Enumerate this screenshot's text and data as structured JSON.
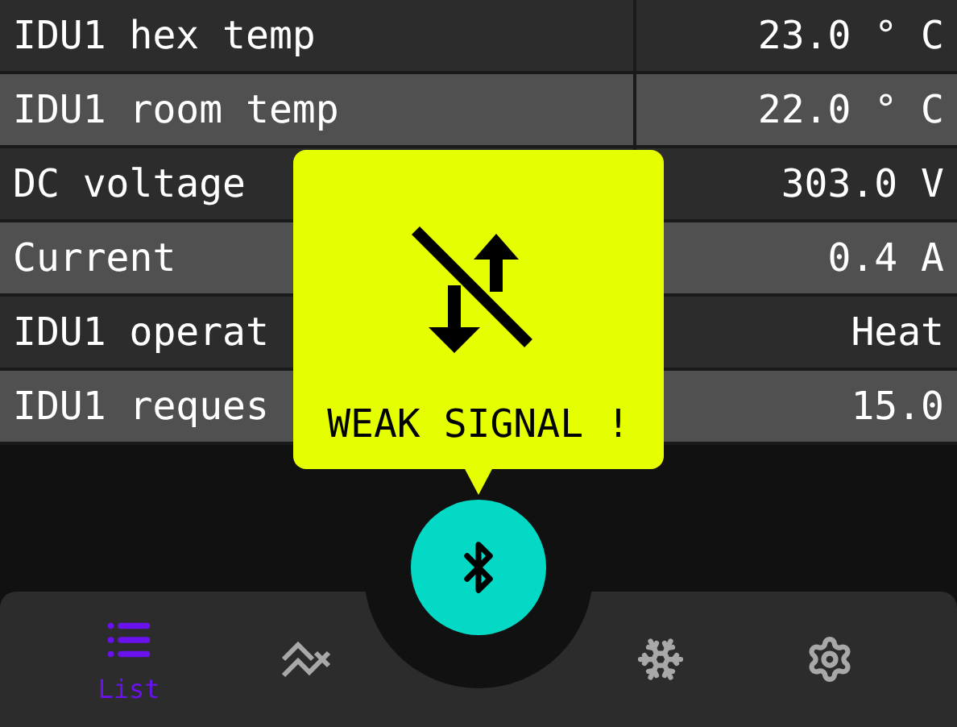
{
  "rows": [
    {
      "label": "IDU1 hex temp",
      "value": "23.0 ° C"
    },
    {
      "label": "IDU1 room temp",
      "value": "22.0 ° C"
    },
    {
      "label": "DC voltage",
      "value": "303.0 V"
    },
    {
      "label": "Current",
      "value": "0.4 A"
    },
    {
      "label": "IDU1 operat",
      "value": "Heat"
    },
    {
      "label": "IDU1 reques",
      "value": "15.0"
    }
  ],
  "popup": {
    "message": "WEAK SIGNAL !"
  },
  "nav": {
    "items": [
      {
        "kind": "list",
        "label": "List",
        "selected": true
      },
      {
        "kind": "chart",
        "selected": false
      },
      {
        "kind": "snowflake",
        "selected": false
      },
      {
        "kind": "settings",
        "selected": false
      }
    ]
  }
}
